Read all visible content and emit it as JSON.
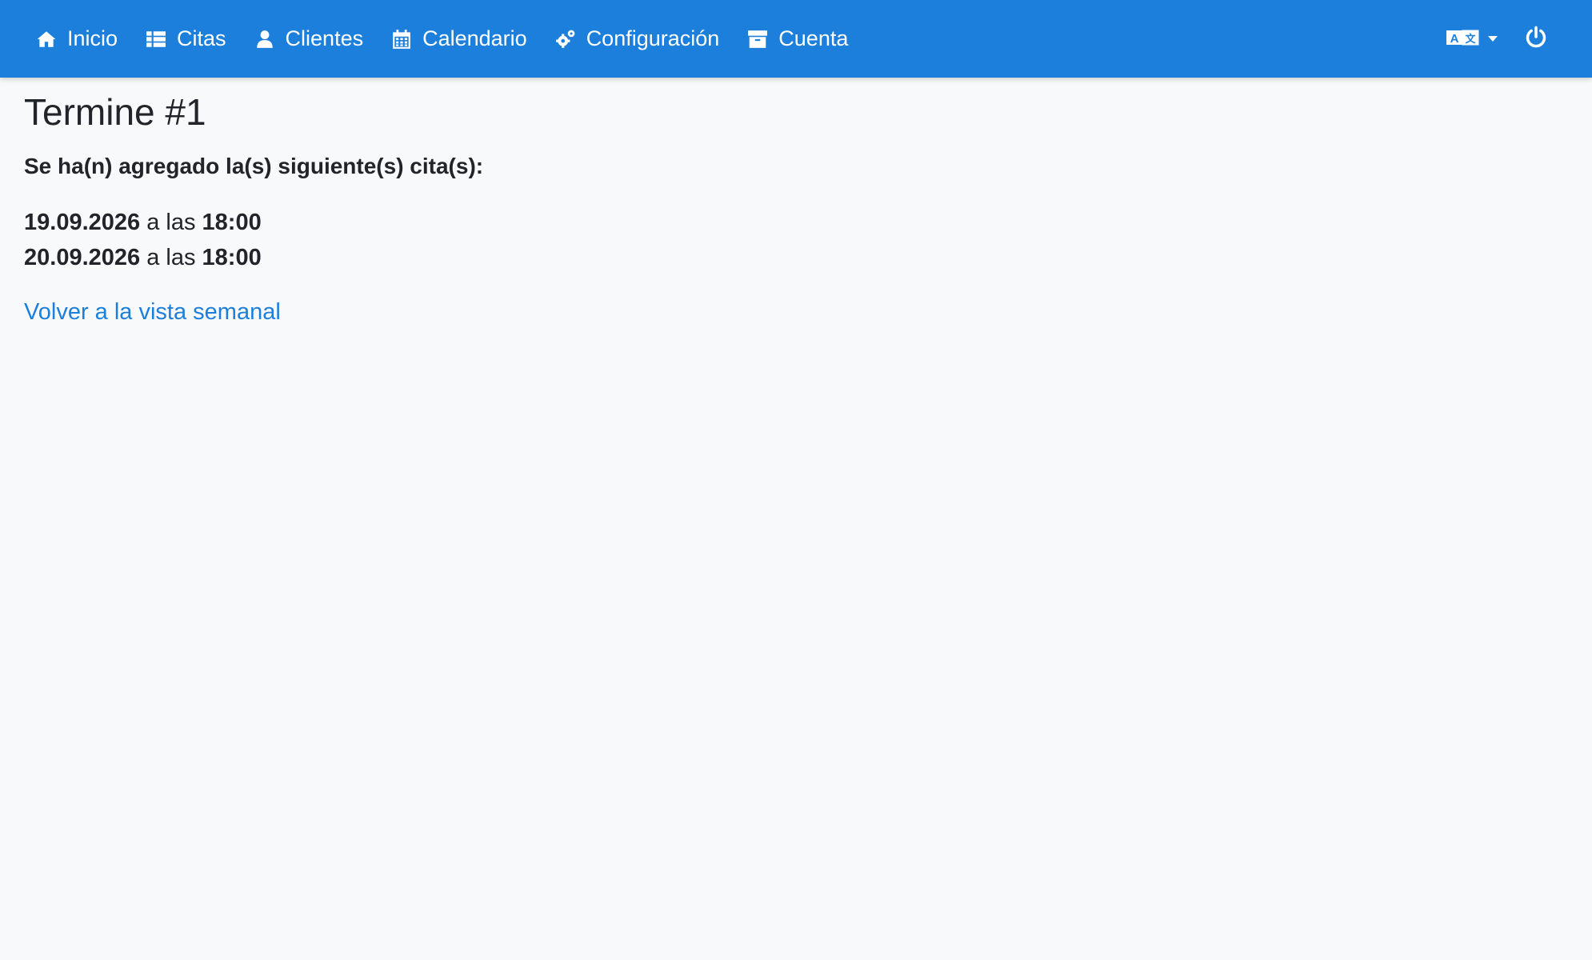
{
  "navbar": {
    "background": "#1b7fdb",
    "items": [
      {
        "label": "Inicio",
        "icon": "home-icon"
      },
      {
        "label": "Citas",
        "icon": "list-icon"
      },
      {
        "label": "Clientes",
        "icon": "user-icon"
      },
      {
        "label": "Calendario",
        "icon": "calendar-icon"
      },
      {
        "label": "Configuración",
        "icon": "gears-icon"
      },
      {
        "label": "Cuenta",
        "icon": "archive-icon"
      }
    ],
    "right": {
      "language_icon": "language-icon",
      "logout_icon": "power-icon"
    }
  },
  "page": {
    "title": "Termine #1",
    "notice": "Se ha(n) agregado la(s) siguiente(s) cita(s):",
    "appointments": [
      {
        "date": "19.09.2026",
        "connector": "a las",
        "time": "18:00"
      },
      {
        "date": "20.09.2026",
        "connector": "a las",
        "time": "18:00"
      }
    ],
    "back_link": "Volver a la vista semanal",
    "link_color": "#1b7fdb"
  }
}
